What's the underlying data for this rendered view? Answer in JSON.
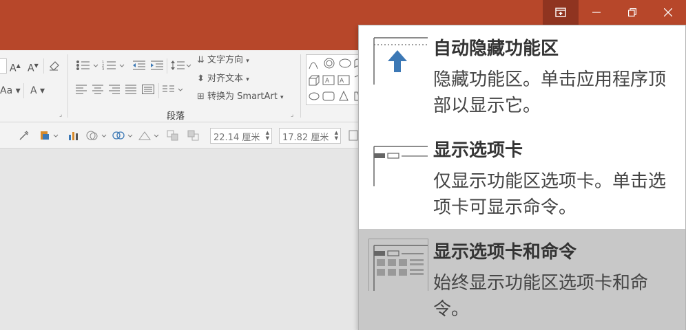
{
  "window_controls": {
    "display_options_icon": "ribbon-display-options-icon",
    "minimize_icon": "minimize-icon",
    "restore_icon": "restore-icon",
    "close_icon": "close-icon"
  },
  "ribbon": {
    "text_direction": "文字方向",
    "align_text": "对齐文本",
    "convert_smartart": "转换为 SmartArt",
    "paragraph_group": "段落",
    "font_grow": "A",
    "font_shrink": "A",
    "font_case": "Aa",
    "font_color": "A"
  },
  "toolbar": {
    "height_value": "22.14 厘米",
    "width_value": "17.82 厘米"
  },
  "menu": {
    "options": [
      {
        "title": "自动隐藏功能区",
        "description": "隐藏功能区。单击应用程序顶部以显示它。",
        "selected": false
      },
      {
        "title": "显示选项卡",
        "description": "仅显示功能区选项卡。单击选项卡可显示命令。",
        "selected": false
      },
      {
        "title": "显示选项卡和命令",
        "description": "始终显示功能区选项卡和命令。",
        "selected": true
      }
    ]
  },
  "colors": {
    "title_bar": "#b7472a",
    "accent_blue": "#3c78b5",
    "selected_item": "#c8c8c8"
  }
}
